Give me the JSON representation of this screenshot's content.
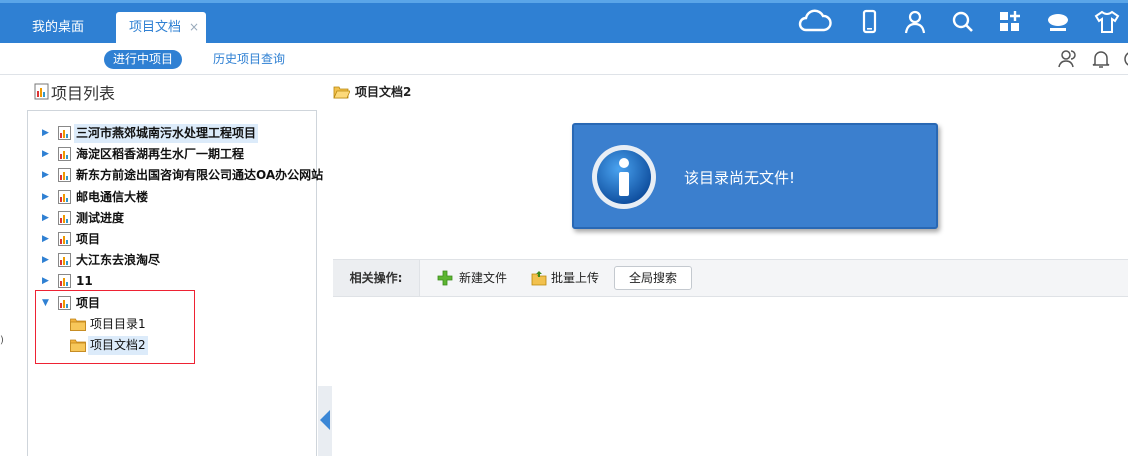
{
  "tabs": {
    "desktop": "我的桌面",
    "project_docs": "项目文档",
    "close": "×"
  },
  "topbar_icons": [
    "cloud-icon",
    "phone-icon",
    "user-icon",
    "search-icon",
    "apps-icon",
    "chat-icon",
    "shirt-icon"
  ],
  "subnav": {
    "active": "进行中项目",
    "history": "历史项目查询"
  },
  "left_panel": {
    "title": "项目列表",
    "tree": [
      {
        "label": "三河市燕郊城南污水处理工程项目",
        "expanded": false,
        "selected": true
      },
      {
        "label": "海淀区稻香湖再生水厂一期工程",
        "expanded": false
      },
      {
        "label": "新东方前途出国咨询有限公司通达OA办公网站",
        "expanded": false
      },
      {
        "label": "邮电通信大楼",
        "expanded": false
      },
      {
        "label": "测试进度",
        "expanded": false
      },
      {
        "label": "项目",
        "expanded": false
      },
      {
        "label": "大江东去浪淘尽",
        "expanded": false
      },
      {
        "label": "11",
        "expanded": false
      },
      {
        "label": "项目",
        "expanded": true,
        "children": [
          {
            "label": "项目目录1"
          },
          {
            "label": "项目文档2",
            "selected": true
          }
        ]
      }
    ]
  },
  "right_panel": {
    "breadcrumb": "项目文档2",
    "empty_message": "该目录尚无文件!",
    "ops": {
      "label": "相关操作:",
      "new_file": "新建文件",
      "batch_upload": "批量上传",
      "global_search": "全局搜索"
    }
  },
  "colors": {
    "primary": "#2f80d3",
    "message_bg": "#3b7fce",
    "highlight": "#dcebfa",
    "red_outline": "#e22233"
  }
}
